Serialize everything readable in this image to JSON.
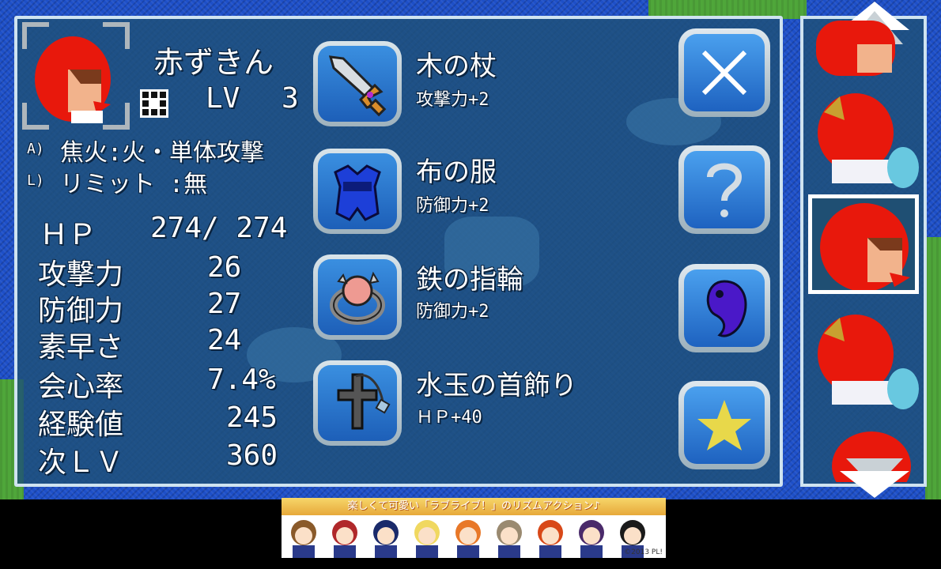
{
  "character": {
    "name": "赤ずきん",
    "level_label": "LV",
    "level": "3",
    "skill_a_prefix": "A)",
    "skill_a": "焦火:火・単体攻撃",
    "skill_l_prefix": "L)",
    "skill_l": "リミット :無"
  },
  "stats": [
    {
      "label": "ＨＰ",
      "value": "274/ 274"
    },
    {
      "label": "攻撃力",
      "value": "26"
    },
    {
      "label": "防御力",
      "value": "27"
    },
    {
      "label": "素早さ",
      "value": "24"
    },
    {
      "label": "会心率",
      "value": "7.4%"
    },
    {
      "label": "経験値",
      "value": "245"
    },
    {
      "label": "次ＬＶ",
      "value": "360"
    }
  ],
  "equipment": [
    {
      "name": "木の杖",
      "effect": "攻撃力+2",
      "icon": "sword-icon"
    },
    {
      "name": "布の服",
      "effect": "防御力+2",
      "icon": "armor-icon"
    },
    {
      "name": "鉄の指輪",
      "effect": "防御力+2",
      "icon": "ring-icon"
    },
    {
      "name": "水玉の首飾り",
      "effect": "ＨＰ+40",
      "icon": "necklace-icon"
    }
  ],
  "side_buttons": [
    {
      "name": "close",
      "icon": "close-icon"
    },
    {
      "name": "help",
      "icon": "question-icon"
    },
    {
      "name": "magatama",
      "icon": "magatama-icon"
    },
    {
      "name": "favorite",
      "icon": "star-icon"
    }
  ],
  "party": {
    "selected_index": 2,
    "member_icons": [
      "red-hood-icon",
      "red-hood-sailor-icon",
      "red-hood-icon",
      "red-hood-sailor-icon",
      "red-hood-icon"
    ]
  },
  "ad": {
    "headline": "楽しくて可愛い「ラブライブ！」のリズムアクション♪",
    "copyright": "©2013 PL!"
  },
  "colors": {
    "panel": "#1e5078",
    "water": "#1d4fc8",
    "hood_red": "#e8180c",
    "button_blue": "#2a78d6",
    "star": "#e8d84a"
  }
}
